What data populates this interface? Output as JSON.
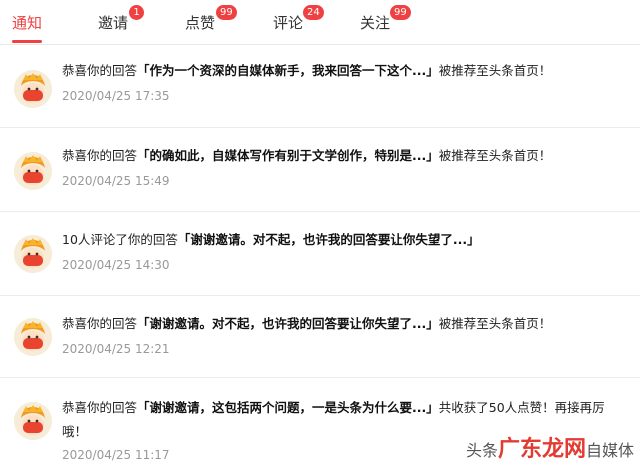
{
  "tabs": [
    {
      "label": "通知",
      "badge": ""
    },
    {
      "label": "邀请",
      "badge": "1"
    },
    {
      "label": "点赞",
      "badge": "99"
    },
    {
      "label": "评论",
      "badge": "24"
    },
    {
      "label": "关注",
      "badge": "99"
    }
  ],
  "notifications": [
    {
      "prefix": "恭喜你的回答",
      "title": "「作为一个资深的自媒体新手，我来回答一下这个...」",
      "suffix": "被推荐至头条首页！",
      "suffix2": "",
      "time": "2020/04/25 17:35"
    },
    {
      "prefix": "恭喜你的回答",
      "title": "「的确如此，自媒体写作有别于文学创作，特别是...」",
      "suffix": "被推荐至头条首页！",
      "suffix2": "",
      "time": "2020/04/25 15:49"
    },
    {
      "prefix": "10人评论了你的回答",
      "title": "「谢谢邀请。对不起，也许我的回答要让你失望了...」",
      "suffix": "",
      "suffix2": "",
      "time": "2020/04/25 14:30"
    },
    {
      "prefix": "恭喜你的回答",
      "title": "「谢谢邀请。对不起，也许我的回答要让你失望了...」",
      "suffix": "被推荐至头条首页！",
      "suffix2": "",
      "time": "2020/04/25 12:21"
    },
    {
      "prefix": "恭喜你的回答",
      "title": "「谢谢邀请，这包括两个问题，一是头条为什么要...」",
      "suffix": "共收获了50人点赞！再接再厉",
      "suffix2": "哦！",
      "time": "2020/04/25 11:17"
    }
  ],
  "watermark": {
    "text1": "头条",
    "big": "广东龙网",
    "text2": "自媒体"
  },
  "colors": {
    "accent": "#f04142",
    "time": "#999999"
  }
}
